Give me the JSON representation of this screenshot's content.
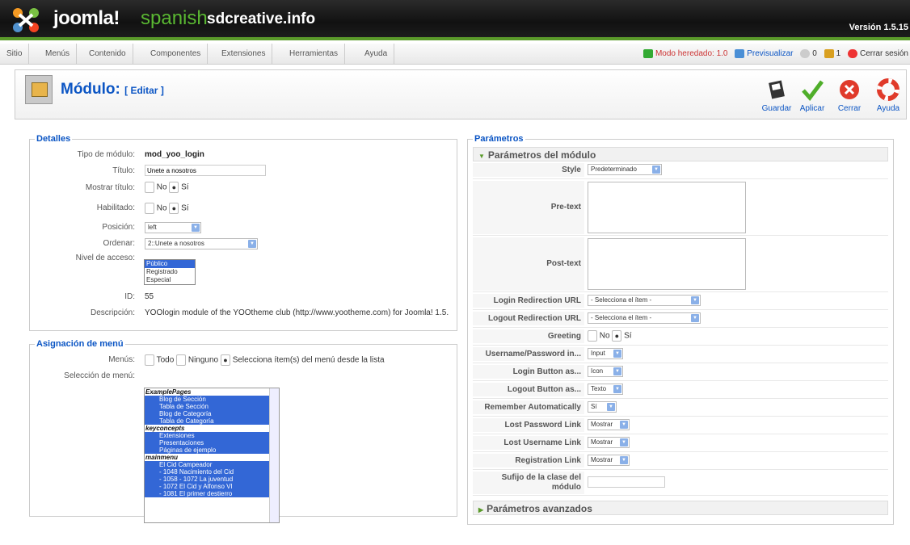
{
  "header": {
    "brand": "joomla!",
    "spanish": "spanish",
    "site": "sdcreative.info",
    "version": "Versión 1.5.15"
  },
  "menu": {
    "items": [
      "Sitio",
      "Menús",
      "Contenido",
      "Componentes",
      "Extensiones",
      "Herramientas",
      "Ayuda"
    ]
  },
  "status": {
    "legacy": "Modo heredado: 1.0",
    "preview": "Previsualizar",
    "messages": "0",
    "users": "1",
    "logout": "Cerrar sesión"
  },
  "toolbar": {
    "title": "Módulo:",
    "subtitle": "[ Editar ]",
    "save": "Guardar",
    "apply": "Aplicar",
    "close": "Cerrar",
    "help": "Ayuda"
  },
  "details": {
    "legend": "Detalles",
    "module_type_label": "Tipo de módulo:",
    "module_type": "mod_yoo_login",
    "title_label": "Título:",
    "title_value": "Unete a nosotros",
    "show_title_label": "Mostrar título:",
    "enabled_label": "Habilitado:",
    "no": "No",
    "yes": "Sí",
    "position_label": "Posición:",
    "position": "left",
    "order_label": "Ordenar:",
    "order": "2::Unete a nosotros",
    "access_label": "Nivel de acceso:",
    "access_options": [
      "Público",
      "Registrado",
      "Especial"
    ],
    "id_label": "ID:",
    "id": "55",
    "desc_label": "Descripción:",
    "desc": "YOOlogin module of the YOOtheme club (http://www.yootheme.com) for Joomla! 1.5."
  },
  "menu_assignment": {
    "legend": "Asignación de menú",
    "menus_label": "Menús:",
    "all": "Todo",
    "none": "Ninguno",
    "select": "Selecciona ítem(s) del menú desde la lista",
    "selection_label": "Selección de menú:",
    "groups": [
      {
        "name": "ExamplePages",
        "items": [
          "Blog de Sección",
          "Tabla de Sección",
          "Blog de Categoría",
          "Tabla de Categoría"
        ]
      },
      {
        "name": "keyconcepts",
        "items": [
          "Extensiones",
          "Presentaciones",
          "Páginas de ejemplo"
        ]
      },
      {
        "name": "mainmenu",
        "items": [
          "El Cid Campeador",
          "- 1048 Nacimiento del Cid",
          "- 1058 - 1072 La juventud",
          "- 1072 El Cid y Alfonso VI",
          "- 1081 El primer destierro"
        ]
      }
    ]
  },
  "params": {
    "legend": "Parámetros",
    "module_params": "Parámetros del módulo",
    "advanced": "Parámetros avanzados",
    "style_label": "Style",
    "style": "Predeterminado",
    "pretext_label": "Pre-text",
    "posttext_label": "Post-text",
    "login_redirect_label": "Login Redirection URL",
    "logout_redirect_label": "Logout Redirection URL",
    "redirect_value": "- Selecciona el ítem -",
    "greeting_label": "Greeting",
    "username_label": "Username/Password in...",
    "username": "Input",
    "login_btn_label": "Login Button as...",
    "login_btn": "Icon",
    "logout_btn_label": "Logout Button as...",
    "logout_btn": "Texto",
    "remember_label": "Remember Automatically",
    "remember": "Sí",
    "lost_pw_label": "Lost Password Link",
    "lost_user_label": "Lost Username Link",
    "reg_label": "Registration Link",
    "show": "Mostrar",
    "suffix_label": "Sufijo de la clase del módulo"
  }
}
